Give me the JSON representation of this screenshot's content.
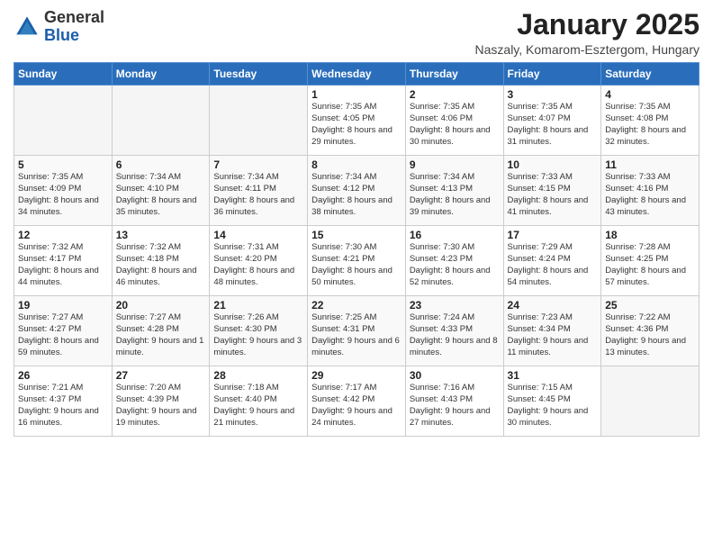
{
  "header": {
    "logo_general": "General",
    "logo_blue": "Blue",
    "main_title": "January 2025",
    "subtitle": "Naszaly, Komarom-Esztergom, Hungary"
  },
  "days_of_week": [
    "Sunday",
    "Monday",
    "Tuesday",
    "Wednesday",
    "Thursday",
    "Friday",
    "Saturday"
  ],
  "weeks": [
    [
      {
        "day": "",
        "info": ""
      },
      {
        "day": "",
        "info": ""
      },
      {
        "day": "",
        "info": ""
      },
      {
        "day": "1",
        "info": "Sunrise: 7:35 AM\nSunset: 4:05 PM\nDaylight: 8 hours\nand 29 minutes."
      },
      {
        "day": "2",
        "info": "Sunrise: 7:35 AM\nSunset: 4:06 PM\nDaylight: 8 hours\nand 30 minutes."
      },
      {
        "day": "3",
        "info": "Sunrise: 7:35 AM\nSunset: 4:07 PM\nDaylight: 8 hours\nand 31 minutes."
      },
      {
        "day": "4",
        "info": "Sunrise: 7:35 AM\nSunset: 4:08 PM\nDaylight: 8 hours\nand 32 minutes."
      }
    ],
    [
      {
        "day": "5",
        "info": "Sunrise: 7:35 AM\nSunset: 4:09 PM\nDaylight: 8 hours\nand 34 minutes."
      },
      {
        "day": "6",
        "info": "Sunrise: 7:34 AM\nSunset: 4:10 PM\nDaylight: 8 hours\nand 35 minutes."
      },
      {
        "day": "7",
        "info": "Sunrise: 7:34 AM\nSunset: 4:11 PM\nDaylight: 8 hours\nand 36 minutes."
      },
      {
        "day": "8",
        "info": "Sunrise: 7:34 AM\nSunset: 4:12 PM\nDaylight: 8 hours\nand 38 minutes."
      },
      {
        "day": "9",
        "info": "Sunrise: 7:34 AM\nSunset: 4:13 PM\nDaylight: 8 hours\nand 39 minutes."
      },
      {
        "day": "10",
        "info": "Sunrise: 7:33 AM\nSunset: 4:15 PM\nDaylight: 8 hours\nand 41 minutes."
      },
      {
        "day": "11",
        "info": "Sunrise: 7:33 AM\nSunset: 4:16 PM\nDaylight: 8 hours\nand 43 minutes."
      }
    ],
    [
      {
        "day": "12",
        "info": "Sunrise: 7:32 AM\nSunset: 4:17 PM\nDaylight: 8 hours\nand 44 minutes."
      },
      {
        "day": "13",
        "info": "Sunrise: 7:32 AM\nSunset: 4:18 PM\nDaylight: 8 hours\nand 46 minutes."
      },
      {
        "day": "14",
        "info": "Sunrise: 7:31 AM\nSunset: 4:20 PM\nDaylight: 8 hours\nand 48 minutes."
      },
      {
        "day": "15",
        "info": "Sunrise: 7:30 AM\nSunset: 4:21 PM\nDaylight: 8 hours\nand 50 minutes."
      },
      {
        "day": "16",
        "info": "Sunrise: 7:30 AM\nSunset: 4:23 PM\nDaylight: 8 hours\nand 52 minutes."
      },
      {
        "day": "17",
        "info": "Sunrise: 7:29 AM\nSunset: 4:24 PM\nDaylight: 8 hours\nand 54 minutes."
      },
      {
        "day": "18",
        "info": "Sunrise: 7:28 AM\nSunset: 4:25 PM\nDaylight: 8 hours\nand 57 minutes."
      }
    ],
    [
      {
        "day": "19",
        "info": "Sunrise: 7:27 AM\nSunset: 4:27 PM\nDaylight: 8 hours\nand 59 minutes."
      },
      {
        "day": "20",
        "info": "Sunrise: 7:27 AM\nSunset: 4:28 PM\nDaylight: 9 hours\nand 1 minute."
      },
      {
        "day": "21",
        "info": "Sunrise: 7:26 AM\nSunset: 4:30 PM\nDaylight: 9 hours\nand 3 minutes."
      },
      {
        "day": "22",
        "info": "Sunrise: 7:25 AM\nSunset: 4:31 PM\nDaylight: 9 hours\nand 6 minutes."
      },
      {
        "day": "23",
        "info": "Sunrise: 7:24 AM\nSunset: 4:33 PM\nDaylight: 9 hours\nand 8 minutes."
      },
      {
        "day": "24",
        "info": "Sunrise: 7:23 AM\nSunset: 4:34 PM\nDaylight: 9 hours\nand 11 minutes."
      },
      {
        "day": "25",
        "info": "Sunrise: 7:22 AM\nSunset: 4:36 PM\nDaylight: 9 hours\nand 13 minutes."
      }
    ],
    [
      {
        "day": "26",
        "info": "Sunrise: 7:21 AM\nSunset: 4:37 PM\nDaylight: 9 hours\nand 16 minutes."
      },
      {
        "day": "27",
        "info": "Sunrise: 7:20 AM\nSunset: 4:39 PM\nDaylight: 9 hours\nand 19 minutes."
      },
      {
        "day": "28",
        "info": "Sunrise: 7:18 AM\nSunset: 4:40 PM\nDaylight: 9 hours\nand 21 minutes."
      },
      {
        "day": "29",
        "info": "Sunrise: 7:17 AM\nSunset: 4:42 PM\nDaylight: 9 hours\nand 24 minutes."
      },
      {
        "day": "30",
        "info": "Sunrise: 7:16 AM\nSunset: 4:43 PM\nDaylight: 9 hours\nand 27 minutes."
      },
      {
        "day": "31",
        "info": "Sunrise: 7:15 AM\nSunset: 4:45 PM\nDaylight: 9 hours\nand 30 minutes."
      },
      {
        "day": "",
        "info": ""
      }
    ]
  ]
}
